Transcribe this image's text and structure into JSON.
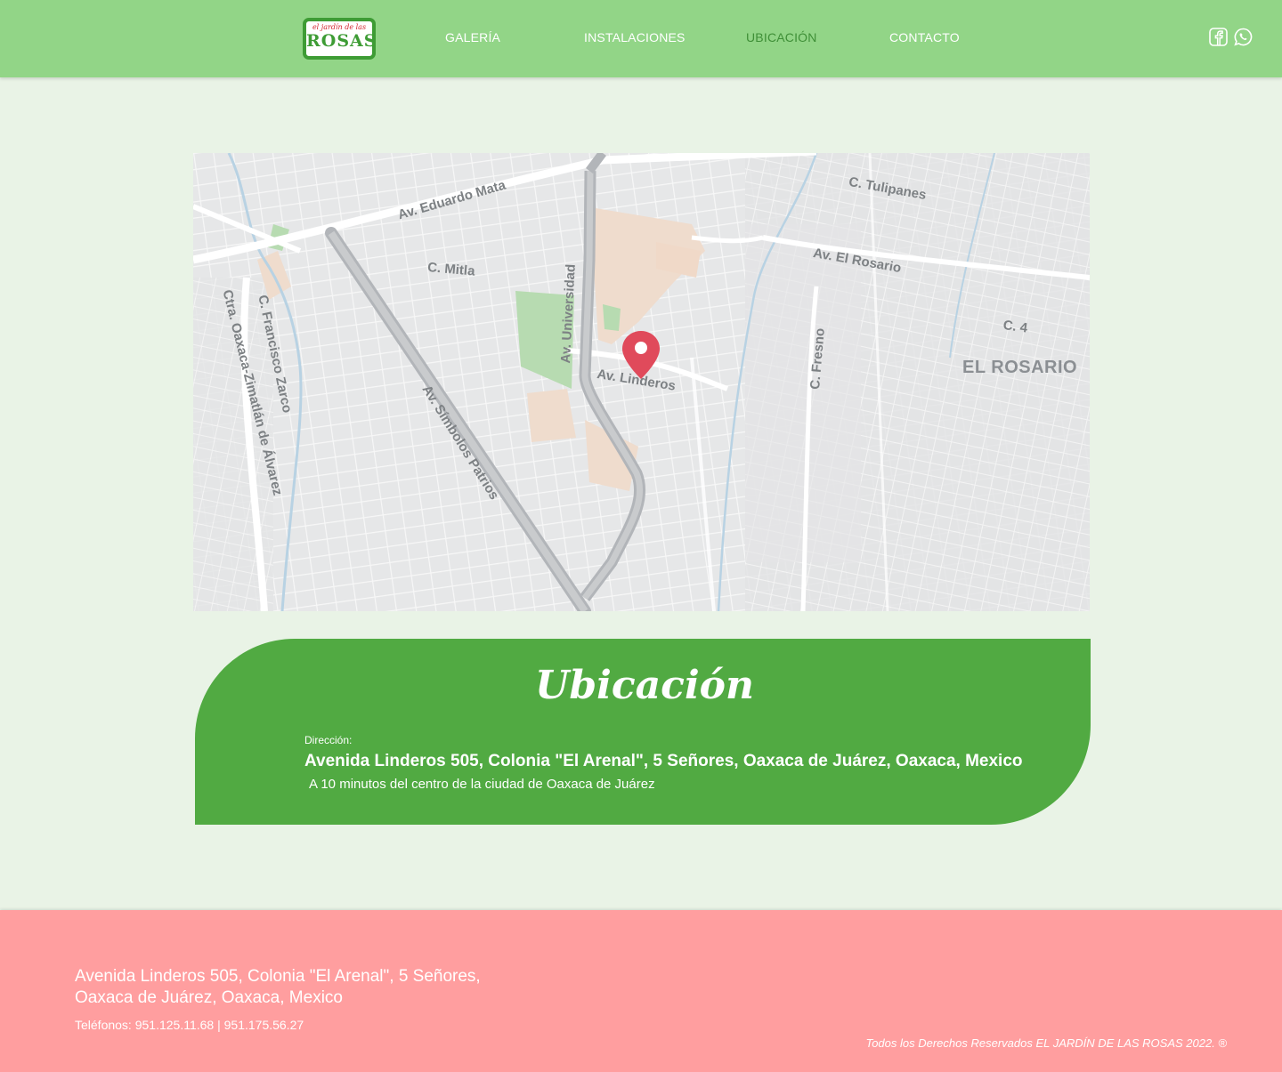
{
  "header": {
    "logo": {
      "top_text": "el jardín de las",
      "main_text": "ROSAS"
    },
    "nav": [
      {
        "label": "GALERÍA",
        "active": false
      },
      {
        "label": "INSTALACIONES",
        "active": false
      },
      {
        "label": "UBICACIÓN",
        "active": true
      },
      {
        "label": "CONTACTO",
        "active": false
      }
    ],
    "social_icons": [
      "facebook-icon",
      "whatsapp-icon"
    ]
  },
  "map": {
    "labels": {
      "eduardo_mata": "Av. Eduardo Mata",
      "tulipanes": "C. Tulipanes",
      "el_rosario_av": "Av. El Rosario",
      "mitla": "C. Mitla",
      "universidad": "Av. Universidad",
      "c4": "C. 4",
      "el_rosario": "EL ROSARIO",
      "fresno": "C. Fresno",
      "linderos": "Av. Linderos",
      "francisco_zarco": "C. Francisco Zarco",
      "ctra": "Ctra. Oaxaca-Zimatlán de Álvarez",
      "simbolos": "Av. Símbolos Patrios"
    },
    "pin_color": "#e04a5b"
  },
  "location": {
    "title": "Ubicación",
    "address_label": "Dirección:",
    "address": "Avenida Linderos 505, Colonia \"El Arenal\", 5 Señores, Oaxaca de Juárez, Oaxaca, Mexico",
    "note": "A 10 minutos del centro de la ciudad de Oaxaca de Juárez"
  },
  "footer": {
    "address_line1": "Avenida Linderos 505, Colonia \"El Arenal\", 5 Señores,",
    "address_line2": "Oaxaca de Juárez, Oaxaca, Mexico",
    "phones": "Teléfonos: 951.125.11.68 | 951.175.56.27",
    "copyright": "Todos los Derechos Reservados EL JARDÍN DE LAS ROSAS 2022. ®"
  },
  "colors": {
    "header_bg": "#92d587",
    "page_bg": "#e9f3e6",
    "card_bg": "#51aa42",
    "footer_bg": "#ff9e9f",
    "active_nav": "#3f8f37"
  }
}
